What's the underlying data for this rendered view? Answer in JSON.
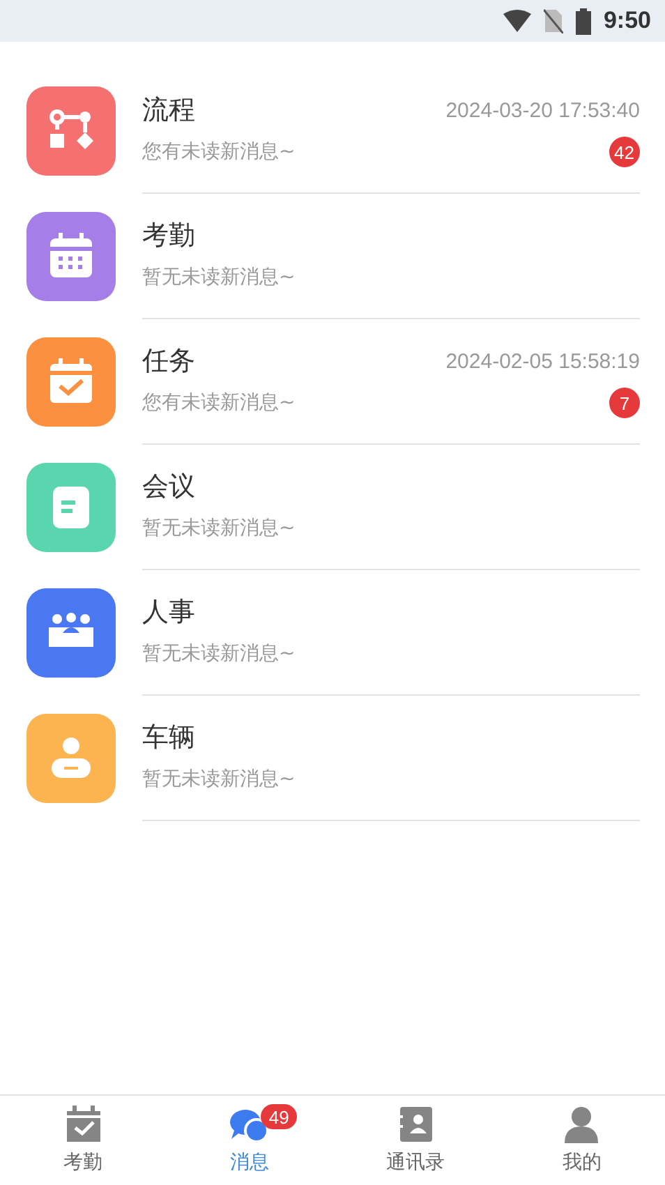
{
  "status_bar": {
    "time": "9:50"
  },
  "messages": [
    {
      "kind": "flow",
      "color": "#f57070",
      "title": "流程",
      "subtitle": "您有未读新消息~",
      "time": "2024-03-20 17:53:40",
      "badge": "42"
    },
    {
      "kind": "calendar",
      "color": "#a57ee8",
      "title": "考勤",
      "subtitle": "暂无未读新消息~"
    },
    {
      "kind": "task",
      "color": "#fb9140",
      "title": "任务",
      "subtitle": "您有未读新消息~",
      "time": "2024-02-05 15:58:19",
      "badge": "7"
    },
    {
      "kind": "note",
      "color": "#5ad6ae",
      "title": "会议",
      "subtitle": "暂无未读新消息~"
    },
    {
      "kind": "team",
      "color": "#4a78f2",
      "title": "人事",
      "subtitle": "暂无未读新消息~"
    },
    {
      "kind": "person",
      "color": "#fbb450",
      "title": "车辆",
      "subtitle": "暂无未读新消息~"
    }
  ],
  "tabs": [
    {
      "kind": "attendance",
      "label": "考勤",
      "selected": false
    },
    {
      "kind": "chat",
      "label": "消息",
      "selected": true,
      "badge": "49"
    },
    {
      "kind": "contacts",
      "label": "通讯录",
      "selected": false
    },
    {
      "kind": "user",
      "label": "我的",
      "selected": false
    }
  ]
}
